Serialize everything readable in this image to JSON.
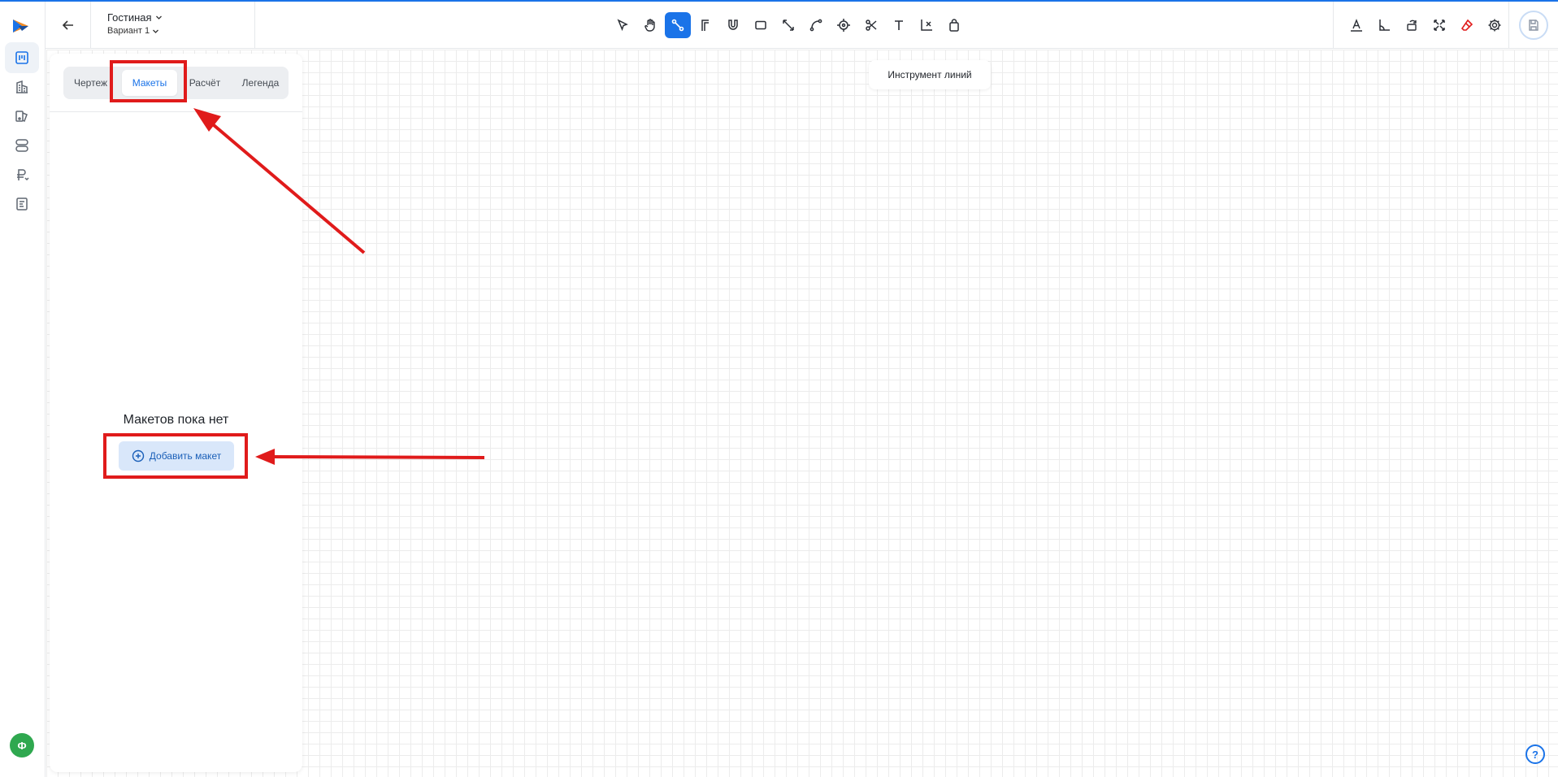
{
  "header": {
    "project_name": "Гостиная",
    "variant_name": "Вариант 1"
  },
  "toolbar": {
    "active_tool": "line-tool",
    "tool_hint": "Инструмент линий",
    "tools": [
      "select-tool",
      "hand-tool",
      "line-tool",
      "wall-tool",
      "magnet-tool",
      "rectangle-tool",
      "diagonal-tool",
      "curve-tool",
      "point-tool",
      "scissors-tool",
      "text-tool",
      "axis-tool",
      "bag-tool"
    ],
    "right_tools": [
      "label-tool",
      "angle-tool",
      "rotate-tool",
      "fit-view-tool",
      "eraser-tool",
      "settings-tool"
    ]
  },
  "sidebar": {
    "items": [
      "layout-icon",
      "building-icon",
      "materials-icon",
      "layers-icon",
      "price-icon",
      "document-icon"
    ],
    "active_item": "layout-icon"
  },
  "panel": {
    "tabs": [
      {
        "label": "Чертеж"
      },
      {
        "label": "Макеты"
      },
      {
        "label": "Расчёт"
      },
      {
        "label": "Легенда"
      }
    ],
    "active_tab": "Макеты",
    "empty_title": "Макетов пока нет",
    "add_button": "Добавить макет"
  },
  "user": {
    "avatar_initial": "Ф"
  },
  "help": {
    "label": "?"
  },
  "colors": {
    "accent": "#1a73e8",
    "annotation": "#e01b1b",
    "avatar": "#2fa84f"
  }
}
